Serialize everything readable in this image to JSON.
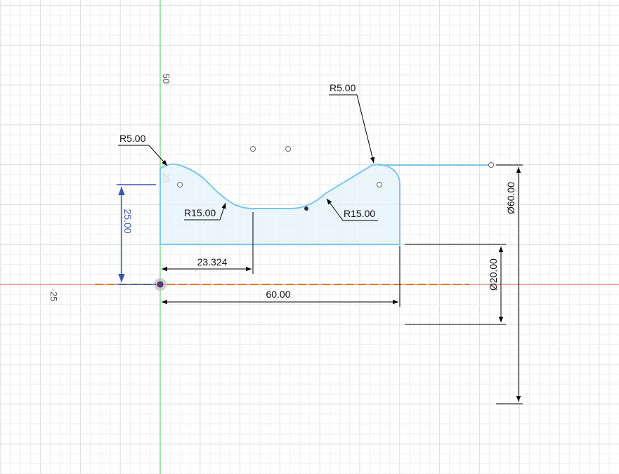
{
  "axis_labels": {
    "y_fifty": "50",
    "y_twenty_five": "25",
    "x_minus_twenty_five": "-25"
  },
  "dimensions": {
    "fillet_left_top": "R5.00",
    "fillet_right_top": "R5.00",
    "arc_left": "R15.00",
    "arc_right": "R15.00",
    "height_left": "25.00",
    "offset_bottom": "23.324",
    "overall_length": "60.00",
    "diameter_small": "Ø20.00",
    "diameter_large": "Ø60.00"
  },
  "colors": {
    "profile_stroke": "#7cc6e8",
    "profile_fill": "#e6f3fb",
    "dimension_line": "#000000",
    "selected_dimension": "#3c55a8",
    "x_axis": "#e05a4a",
    "y_axis": "#4cc94c",
    "centerline": "#d97a2b",
    "grid_minor": "#eeeeee",
    "grid_major": "#dcdcdc"
  }
}
